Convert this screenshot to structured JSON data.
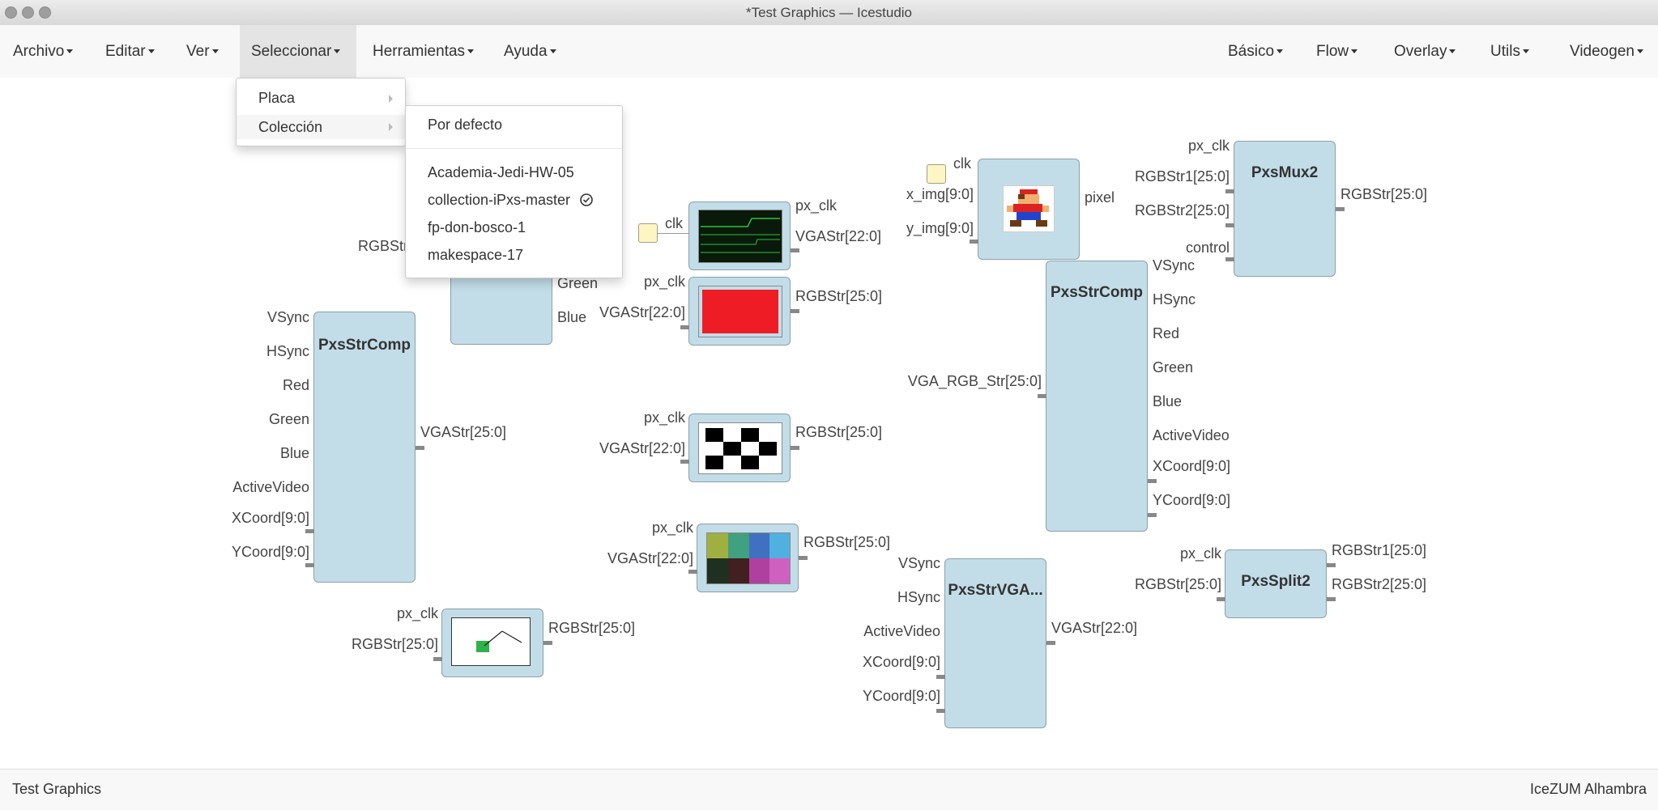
{
  "window": {
    "title": "*Test Graphics — Icestudio"
  },
  "menubar": {
    "left": [
      "Archivo",
      "Editar",
      "Ver",
      "Seleccionar",
      "Herramientas",
      "Ayuda"
    ],
    "right": [
      "Básico",
      "Flow",
      "Overlay",
      "Utils",
      "Videogen"
    ]
  },
  "select_menu": {
    "items": [
      "Placa",
      "Colección"
    ],
    "collection_submenu": {
      "default": "Por defecto",
      "collections": [
        "Academia-Jedi-HW-05",
        "collection-iPxs-master",
        "fp-don-bosco-1",
        "makespace-17"
      ],
      "selected": "collection-iPxs-master"
    }
  },
  "blocks": {
    "strcomp_left": {
      "title": "PxsStrComp",
      "inputs": [
        "VSync",
        "HSync",
        "Red",
        "Green",
        "Blue",
        "ActiveVideo",
        "XCoord[9:0]",
        "YCoord[9:0]"
      ],
      "output": "VGAStr[25:0]"
    },
    "partial_block": {
      "input": "RGBStr",
      "outputs": [
        "Green",
        "Blue"
      ]
    },
    "vga_timing": {
      "const_label": "clk",
      "outputs": [
        "px_clk",
        "VGAStr[22:0]"
      ]
    },
    "red_fill": {
      "input": "VGAStr[22:0]",
      "top_label": "px_clk",
      "output": "RGBStr[25:0]",
      "fill_color": "#ee1c25"
    },
    "checker": {
      "top_label": "px_clk",
      "input": "VGAStr[22:0]",
      "output": "RGBStr[25:0]"
    },
    "palette": {
      "top_label": "px_clk",
      "input": "VGAStr[22:0]",
      "output": "RGBStr[25:0]"
    },
    "bounce": {
      "inputs": [
        "px_clk",
        "RGBStr[25:0]"
      ],
      "output": "RGBStr[25:0]"
    },
    "image": {
      "const_label": "clk",
      "inputs": [
        "x_img[9:0]",
        "y_img[9:0]"
      ],
      "output": "pixel"
    },
    "strcomp_right": {
      "title": "PxsStrComp",
      "input": "VGA_RGB_Str[25:0]",
      "outputs": [
        "VSync",
        "HSync",
        "Red",
        "Green",
        "Blue",
        "ActiveVideo",
        "XCoord[9:0]",
        "YCoord[9:0]"
      ]
    },
    "mux2": {
      "title": "PxsMux2",
      "inputs": [
        "px_clk",
        "RGBStr1[25:0]",
        "RGBStr2[25:0]",
        "control"
      ],
      "output": "RGBStr[25:0]"
    },
    "strvga": {
      "title": "PxsStrVGA...",
      "inputs": [
        "VSync",
        "HSync",
        "ActiveVideo",
        "XCoord[9:0]",
        "YCoord[9:0]"
      ],
      "output": "VGAStr[22:0]"
    },
    "split2": {
      "title": "PxsSplit2",
      "inputs": [
        "px_clk",
        "RGBStr[25:0]"
      ],
      "outputs": [
        "RGBStr1[25:0]",
        "RGBStr2[25:0]"
      ]
    }
  },
  "status": {
    "left": "Test Graphics",
    "right": "IceZUM Alhambra"
  }
}
